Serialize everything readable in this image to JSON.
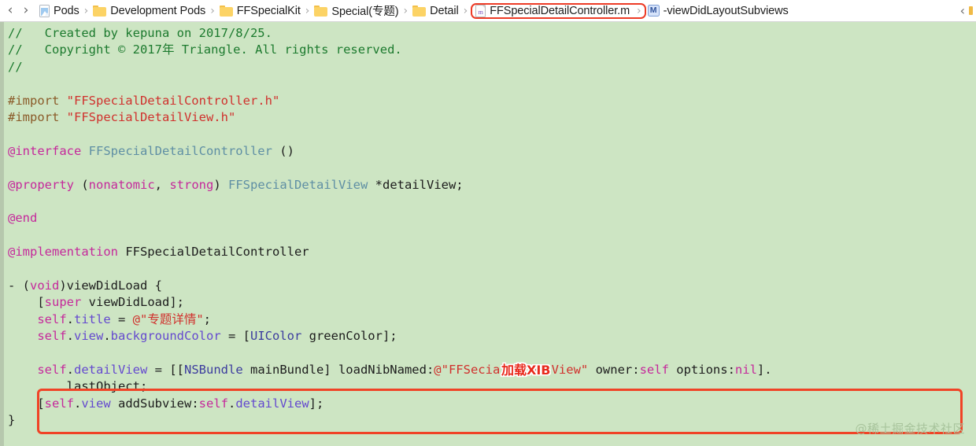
{
  "jumpbar": {
    "back_arrow": "‹",
    "forward_arrow": "›",
    "separator": "›",
    "right_chevron": "‹",
    "crumbs": [
      {
        "label": "Pods",
        "icon": "pods-project-icon",
        "type": "project"
      },
      {
        "label": "Development Pods",
        "icon": "folder-icon",
        "type": "folder"
      },
      {
        "label": "FFSpecialKit",
        "icon": "folder-icon",
        "type": "folder"
      },
      {
        "label": "Special(专题)",
        "icon": "folder-icon",
        "type": "folder"
      },
      {
        "label": "Detail",
        "icon": "folder-icon",
        "type": "folder"
      },
      {
        "label": "FFSpecialDetailController.m",
        "icon": "objc-file-icon",
        "type": "file",
        "icon_glyph": "m",
        "highlighted": true
      },
      {
        "label": "-viewDidLayoutSubviews",
        "icon": "method-symbol-icon",
        "type": "symbol",
        "icon_glyph": "M"
      }
    ]
  },
  "editor": {
    "language": "objective-c",
    "lines": [
      [
        {
          "t": "//   Created by kepuna on 2017/8/25.",
          "c": "c-comment"
        }
      ],
      [
        {
          "t": "//   Copyright © 2017年 Triangle. All rights reserved.",
          "c": "c-comment"
        }
      ],
      [
        {
          "t": "//",
          "c": "c-comment"
        }
      ],
      [
        {
          "t": "",
          "c": "c-plain"
        }
      ],
      [
        {
          "t": "#import ",
          "c": "c-pre"
        },
        {
          "t": "\"FFSpecialDetailController.h\"",
          "c": "c-str"
        }
      ],
      [
        {
          "t": "#import ",
          "c": "c-pre"
        },
        {
          "t": "\"FFSpecialDetailView.h\"",
          "c": "c-str"
        }
      ],
      [
        {
          "t": "",
          "c": "c-plain"
        }
      ],
      [
        {
          "t": "@interface ",
          "c": "c-kw"
        },
        {
          "t": "FFSpecialDetailController",
          "c": "c-type"
        },
        {
          "t": " ()",
          "c": "c-plain"
        }
      ],
      [
        {
          "t": "",
          "c": "c-plain"
        }
      ],
      [
        {
          "t": "@property ",
          "c": "c-kw"
        },
        {
          "t": "(",
          "c": "c-plain"
        },
        {
          "t": "nonatomic",
          "c": "c-kw"
        },
        {
          "t": ", ",
          "c": "c-plain"
        },
        {
          "t": "strong",
          "c": "c-kw"
        },
        {
          "t": ") ",
          "c": "c-plain"
        },
        {
          "t": "FFSpecialDetailView",
          "c": "c-type"
        },
        {
          "t": " *detailView;",
          "c": "c-plain"
        }
      ],
      [
        {
          "t": "",
          "c": "c-plain"
        }
      ],
      [
        {
          "t": "@end",
          "c": "c-kw"
        }
      ],
      [
        {
          "t": "",
          "c": "c-plain"
        }
      ],
      [
        {
          "t": "@implementation ",
          "c": "c-kw"
        },
        {
          "t": "FFSpecialDetailController",
          "c": "c-plain"
        }
      ],
      [
        {
          "t": "",
          "c": "c-plain"
        }
      ],
      [
        {
          "t": "- (",
          "c": "c-plain"
        },
        {
          "t": "void",
          "c": "c-kw"
        },
        {
          "t": ")viewDidLoad {",
          "c": "c-plain"
        }
      ],
      [
        {
          "t": "    [",
          "c": "c-plain"
        },
        {
          "t": "super",
          "c": "c-kw"
        },
        {
          "t": " viewDidLoad];",
          "c": "c-plain"
        }
      ],
      [
        {
          "t": "    ",
          "c": "c-plain"
        },
        {
          "t": "self",
          "c": "c-kw"
        },
        {
          "t": ".",
          "c": "c-plain"
        },
        {
          "t": "title",
          "c": "c-prop"
        },
        {
          "t": " = ",
          "c": "c-plain"
        },
        {
          "t": "@\"专题详情\"",
          "c": "c-str"
        },
        {
          "t": ";",
          "c": "c-plain"
        }
      ],
      [
        {
          "t": "    ",
          "c": "c-plain"
        },
        {
          "t": "self",
          "c": "c-kw"
        },
        {
          "t": ".",
          "c": "c-plain"
        },
        {
          "t": "view",
          "c": "c-prop"
        },
        {
          "t": ".",
          "c": "c-plain"
        },
        {
          "t": "backgroundColor",
          "c": "c-prop"
        },
        {
          "t": " = [",
          "c": "c-plain"
        },
        {
          "t": "UIColor",
          "c": "c-cls"
        },
        {
          "t": " greenColor];",
          "c": "c-plain"
        }
      ],
      [
        {
          "t": "",
          "c": "c-plain"
        }
      ],
      [
        {
          "t": "    ",
          "c": "c-plain"
        },
        {
          "t": "self",
          "c": "c-kw"
        },
        {
          "t": ".",
          "c": "c-plain"
        },
        {
          "t": "detailView",
          "c": "c-prop"
        },
        {
          "t": " = [[",
          "c": "c-plain"
        },
        {
          "t": "NSBundle",
          "c": "c-cls"
        },
        {
          "t": " mainBundle] loadNibNamed:",
          "c": "c-plain"
        },
        {
          "t": "@\"FFSecialDetailView\"",
          "c": "c-str"
        },
        {
          "t": " owner:",
          "c": "c-plain"
        },
        {
          "t": "self",
          "c": "c-kw"
        },
        {
          "t": " options:",
          "c": "c-plain"
        },
        {
          "t": "nil",
          "c": "c-kw"
        },
        {
          "t": "].",
          "c": "c-plain"
        }
      ],
      [
        {
          "t": "        lastObject;",
          "c": "c-plain"
        }
      ],
      [
        {
          "t": "    [",
          "c": "c-plain"
        },
        {
          "t": "self",
          "c": "c-kw"
        },
        {
          "t": ".",
          "c": "c-plain"
        },
        {
          "t": "view",
          "c": "c-prop"
        },
        {
          "t": " addSubview:",
          "c": "c-plain"
        },
        {
          "t": "self",
          "c": "c-kw"
        },
        {
          "t": ".",
          "c": "c-plain"
        },
        {
          "t": "detailView",
          "c": "c-prop"
        },
        {
          "t": "];",
          "c": "c-plain"
        }
      ],
      [
        {
          "t": "}",
          "c": "c-plain"
        }
      ]
    ]
  },
  "annotations": {
    "xib_badge": "加载XIB",
    "watermark": "@稀土掘金技术社区"
  },
  "colors": {
    "editor_background": "#cde5c3",
    "gutter": "#b6c8ad",
    "highlight_red": "#f04326",
    "comment_green": "#1c7a2e",
    "string_red": "#d0312d",
    "keyword_magenta": "#c5289b",
    "type_teal": "#5f8fa4",
    "property_purple": "#6449cf",
    "class_blue": "#3c3c9e",
    "preprocessor_brown": "#8a5a28",
    "badge_red": "#e8291c",
    "watermark_green": "#a8c49c"
  }
}
